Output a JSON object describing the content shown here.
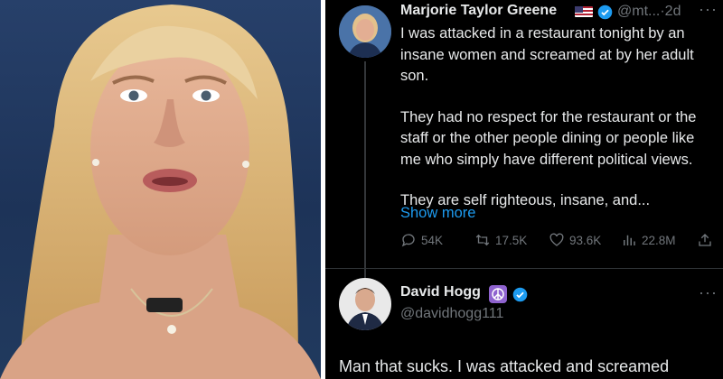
{
  "tweet": {
    "author_name": "Marjorie Taylor Greene",
    "flag_icon": "us-flag-icon",
    "handle_time": "@mt...·2d",
    "paragraphs": [
      "I was attacked in a restaurant tonight by an insane women and screamed at by her adult son.",
      "They had no respect for the restaurant or the staff or the other people dining or people like me who simply have different political views.",
      "They are self righteous, insane, and..."
    ],
    "show_more": "Show more",
    "stats": {
      "replies": "54K",
      "reposts": "17.5K",
      "likes": "93.6K",
      "views": "22.8M"
    }
  },
  "reply": {
    "author_name": "David Hogg",
    "handle": "@davidhogg111",
    "text": "Man that sucks. I was attacked and screamed"
  },
  "colors": {
    "background": "#000000",
    "text": "#e7e9ea",
    "muted": "#71767b",
    "link": "#1d9bf0",
    "verified": "#1d9bf0",
    "peace_badge": "#8f63cf"
  }
}
